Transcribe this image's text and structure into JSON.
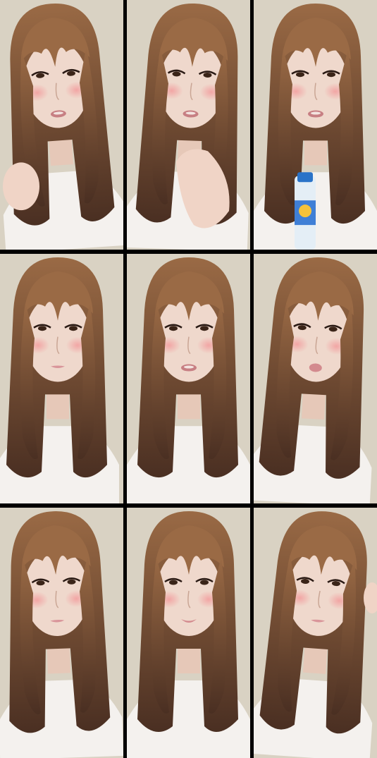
{
  "grid": {
    "rows": 3,
    "columns": 3,
    "frames": [
      {
        "row": 1,
        "col": 1,
        "pose": "looking-left-hand-in-hair"
      },
      {
        "row": 1,
        "col": 2,
        "pose": "hand-raised-to-chest"
      },
      {
        "row": 1,
        "col": 3,
        "pose": "holding-drink-bottle"
      },
      {
        "row": 2,
        "col": 1,
        "pose": "neutral-front"
      },
      {
        "row": 2,
        "col": 2,
        "pose": "lips-parted"
      },
      {
        "row": 2,
        "col": 3,
        "pose": "pouting"
      },
      {
        "row": 3,
        "col": 1,
        "pose": "eyes-lowered"
      },
      {
        "row": 3,
        "col": 2,
        "pose": "slight-smile"
      },
      {
        "row": 3,
        "col": 3,
        "pose": "hand-touching-hair"
      }
    ]
  },
  "colors": {
    "background_wall": "#d9d2c3",
    "hair_light": "#9a6a45",
    "hair_dark": "#4a2f22",
    "skin": "#efd8cc",
    "blush": "#f2a0a0",
    "shirt": "#f4f1ee",
    "separator": "#000000"
  }
}
